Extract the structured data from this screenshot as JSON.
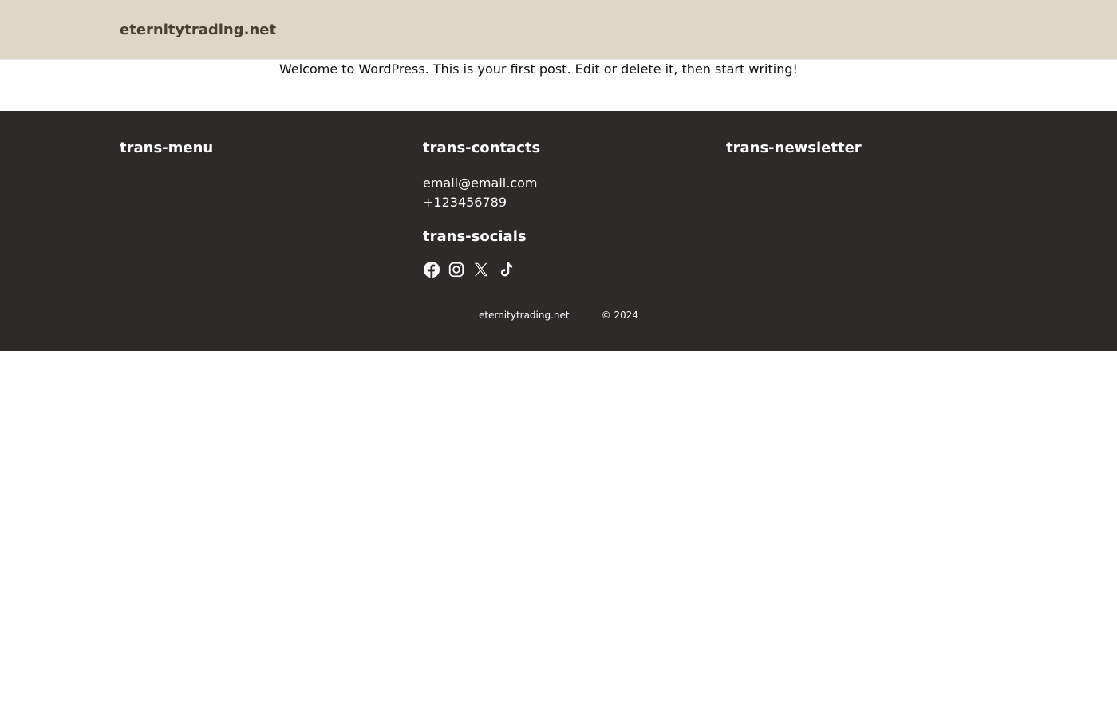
{
  "header": {
    "site_title": "eternitytrading.net"
  },
  "main": {
    "post_text": "Welcome to WordPress. This is your first post. Edit or delete it, then start writing!"
  },
  "footer": {
    "menu_heading": "trans-menu",
    "contacts_heading": "trans-contacts",
    "email": "email@email.com",
    "phone": "+123456789",
    "socials_heading": "trans-socials",
    "newsletter_heading": "trans-newsletter",
    "social_icons": [
      "facebook-icon",
      "instagram-icon",
      "x-icon",
      "tiktok-icon"
    ],
    "bottom_site_name": "eternitytrading.net",
    "copyright": "© 2024"
  },
  "colors": {
    "header_bg": "#dfd7c5",
    "footer_bg": "#2d2a29",
    "site_title": "#4a3f35"
  }
}
